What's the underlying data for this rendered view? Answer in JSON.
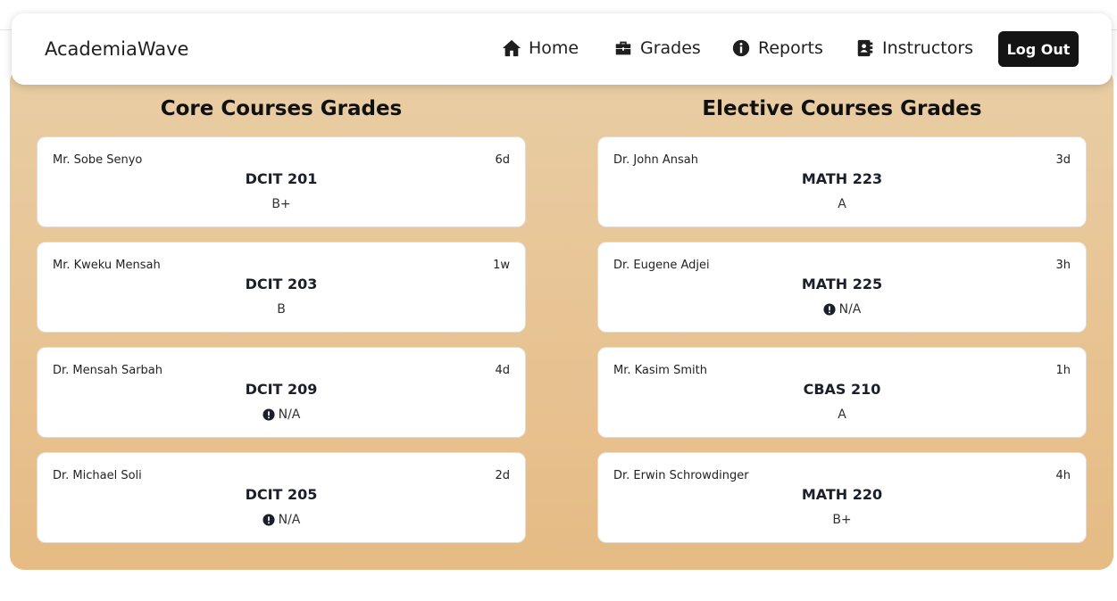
{
  "app": {
    "brand": "AcademiaWave"
  },
  "nav": {
    "home": "Home",
    "grades": "Grades",
    "reports": "Reports",
    "instructors": "Instructors",
    "logout": "Log Out"
  },
  "core": {
    "title": "Core Courses Grades",
    "cards": [
      {
        "instructor": "Mr. Sobe Senyo",
        "time": "6d",
        "code": "DCIT 201",
        "grade": "B+",
        "missing": false
      },
      {
        "instructor": "Mr. Kweku Mensah",
        "time": "1w",
        "code": "DCIT 203",
        "grade": "B",
        "missing": false
      },
      {
        "instructor": "Dr. Mensah Sarbah",
        "time": "4d",
        "code": "DCIT 209",
        "grade": "N/A",
        "missing": true
      },
      {
        "instructor": "Dr. Michael Soli",
        "time": "2d",
        "code": "DCIT 205",
        "grade": "N/A",
        "missing": true
      }
    ]
  },
  "elective": {
    "title": "Elective Courses Grades",
    "cards": [
      {
        "instructor": "Dr. John Ansah",
        "time": "3d",
        "code": "MATH 223",
        "grade": "A",
        "missing": false
      },
      {
        "instructor": "Dr. Eugene Adjei",
        "time": "3h",
        "code": "MATH 225",
        "grade": "N/A",
        "missing": true
      },
      {
        "instructor": "Mr. Kasim Smith",
        "time": "1h",
        "code": "CBAS 210",
        "grade": "A",
        "missing": false
      },
      {
        "instructor": "Dr. Erwin Schrowdinger",
        "time": "4h",
        "code": "MATH 220",
        "grade": "B+",
        "missing": false
      }
    ]
  },
  "icons": {
    "home": "home-icon",
    "grades": "briefcase-icon",
    "reports": "info-circle-icon",
    "instructors": "contact-book-icon",
    "missing": "exclamation-circle-icon"
  },
  "colors": {
    "panel_top": "#e9cda4",
    "panel_bottom": "#e6bb84",
    "button": "#141414"
  }
}
